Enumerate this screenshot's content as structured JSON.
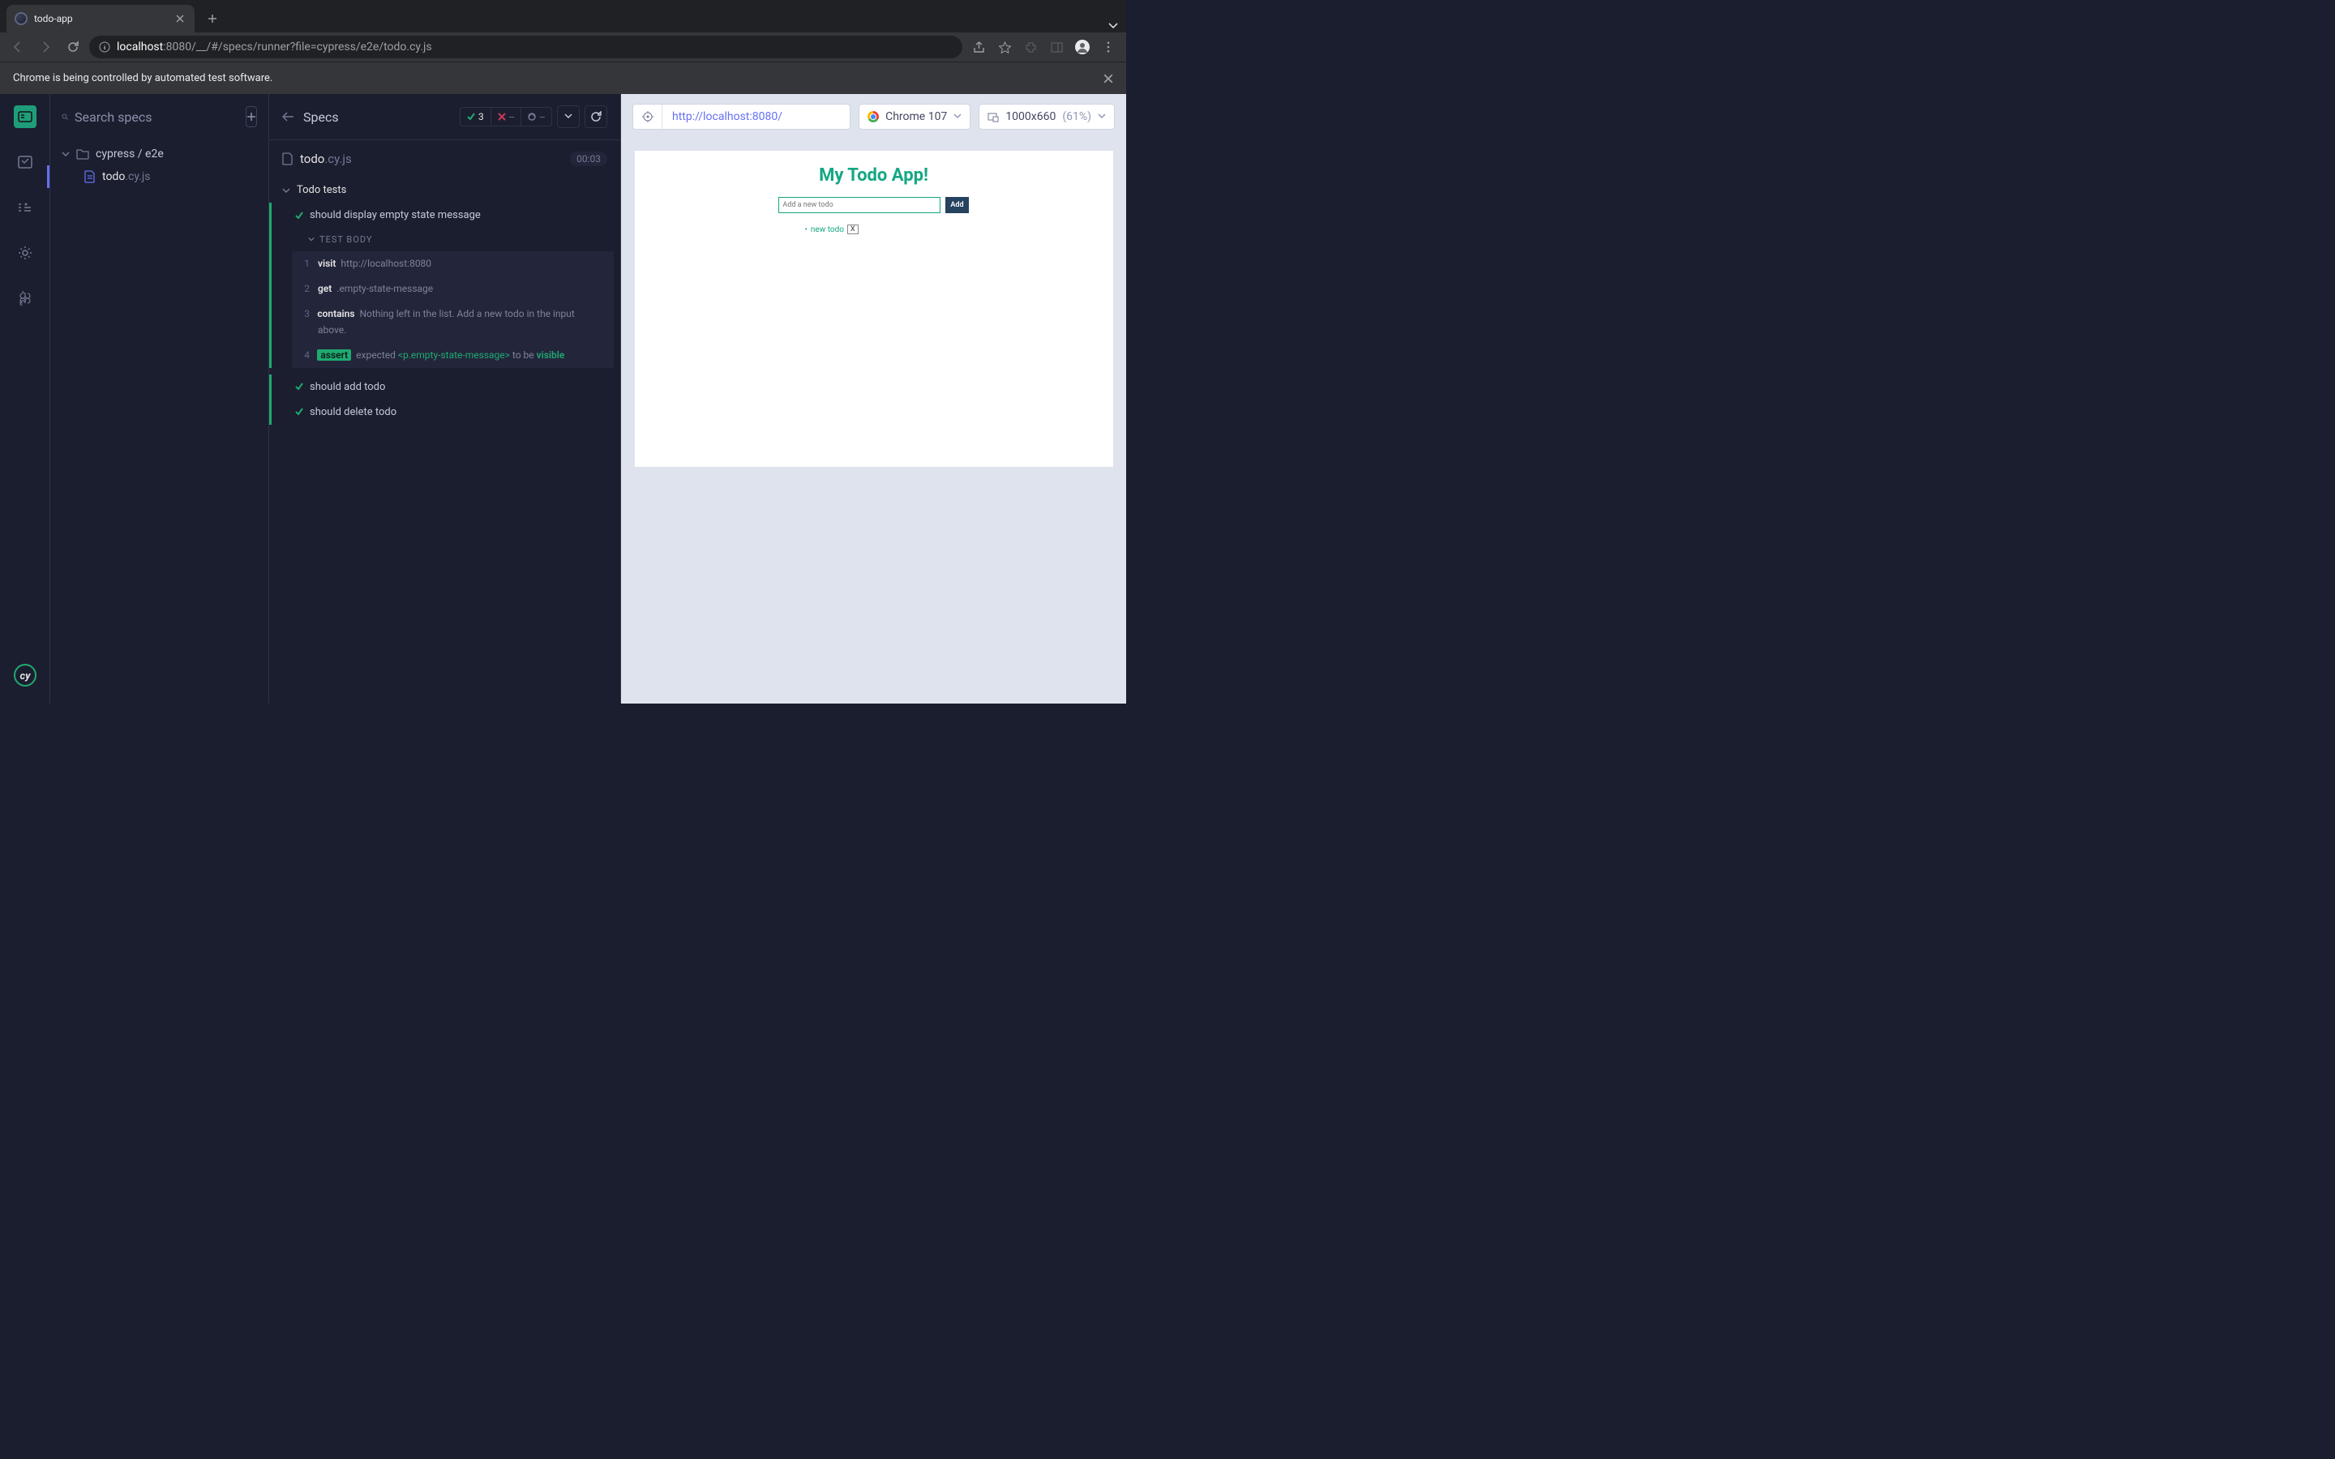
{
  "browser": {
    "tab_title": "todo-app",
    "url_host": "localhost",
    "url_port": ":8080",
    "url_path": "/__/#/specs/runner?file=cypress/e2e/todo.cy.js",
    "automation_banner": "Chrome is being controlled by automated test software."
  },
  "specs": {
    "search_placeholder": "Search specs",
    "folder_path": "cypress / e2e",
    "file_name": "todo",
    "file_ext": ".cy.js"
  },
  "runner": {
    "title": "Specs",
    "pass_count": "3",
    "fail_count": "--",
    "pending_count": "--",
    "spec_name": "todo",
    "spec_ext": ".cy.js",
    "duration": "00:03",
    "describe": "Todo tests",
    "tests": [
      "should display empty state message",
      "should add todo",
      "should delete todo"
    ],
    "body_label": "TEST BODY",
    "commands": [
      {
        "n": "1",
        "name": "visit",
        "arg": "http://localhost:8080"
      },
      {
        "n": "2",
        "name": "get",
        "arg": ".empty-state-message"
      },
      {
        "n": "3",
        "dash": "-",
        "name": "contains",
        "arg": "Nothing left in the list. Add a new todo in the input above."
      },
      {
        "n": "4",
        "dash": "-",
        "assert": "assert",
        "text1": "expected",
        "el": "<p.empty-state-message>",
        "text2": "to be",
        "kw": "visible"
      }
    ]
  },
  "preview": {
    "url": "http://localhost:8080/",
    "browser": "Chrome 107",
    "viewport": "1000x660",
    "scale": "(61%)"
  },
  "app": {
    "title": "My Todo App!",
    "placeholder": "Add a new todo",
    "add_label": "Add",
    "item_text": "new todo",
    "delete_label": "X"
  }
}
